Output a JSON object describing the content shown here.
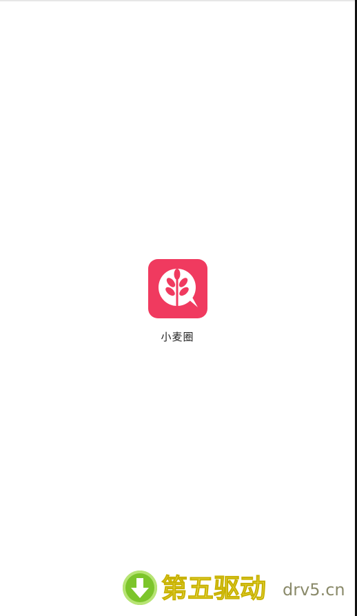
{
  "app": {
    "name": "小麦圈",
    "icon": "wheat-chat-icon",
    "brand_color": "#f03a5f"
  },
  "watermark": {
    "icon": "download-arrow-icon",
    "title": "第五驱动",
    "domain": "drv5.cn",
    "title_color": "#f3e46a",
    "icon_color": "#7cc52b"
  }
}
